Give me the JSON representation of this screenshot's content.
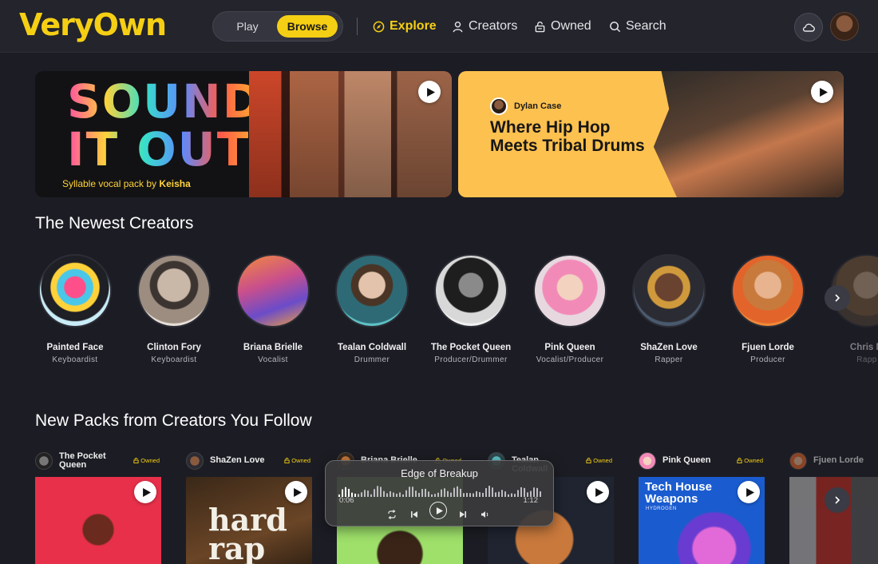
{
  "brand": {
    "logo": "VeryOwn",
    "accent": "#f5cf14"
  },
  "header": {
    "mode_toggle": {
      "play_label": "Play",
      "browse_label": "Browse",
      "selected": "Browse"
    },
    "nav": [
      {
        "label": "Explore",
        "icon": "compass-icon",
        "active": true
      },
      {
        "label": "Creators",
        "icon": "person-icon",
        "active": false
      },
      {
        "label": "Owned",
        "icon": "lock-icon",
        "active": false
      },
      {
        "label": "Search",
        "icon": "search-icon",
        "active": false
      }
    ],
    "cloud_icon": "cloud-icon",
    "user_avatar": "avatar"
  },
  "featured": [
    {
      "art_text": "SOUND IT OUT",
      "caption_prefix": "Syllable vocal pack by",
      "caption_creator": "Keisha",
      "play_icon": "play-icon"
    },
    {
      "author": "Dylan Case",
      "title": "Where Hip Hop Meets Tribal Drums",
      "play_icon": "play-icon"
    }
  ],
  "newest_creators": {
    "heading": "The Newest Creators",
    "items": [
      {
        "name": "Painted Face",
        "role": "Keyboardist"
      },
      {
        "name": "Clinton Fory",
        "role": "Keyboardist"
      },
      {
        "name": "Briana Brielle",
        "role": "Vocalist"
      },
      {
        "name": "Tealan Coldwall",
        "role": "Drummer"
      },
      {
        "name": "The Pocket Queen",
        "role": "Producer/Drummer"
      },
      {
        "name": "Pink Queen",
        "role": "Vocalist/Producer"
      },
      {
        "name": "ShaZen Love",
        "role": "Rapper"
      },
      {
        "name": "Fjuen Lorde",
        "role": "Producer"
      },
      {
        "name": "Chris M",
        "role": "Rapp"
      }
    ]
  },
  "packs_section": {
    "heading": "New Packs from Creators You Follow",
    "owned_label": "Owned",
    "items": [
      {
        "creator": "The Pocket Queen",
        "owned": true,
        "cover_text": ""
      },
      {
        "creator": "ShaZen Love",
        "owned": true,
        "cover_text": "hard rap"
      },
      {
        "creator": "Briana Brielle",
        "owned": true,
        "cover_text": ""
      },
      {
        "creator": "Tealan Coldwall",
        "owned": true,
        "cover_text": ""
      },
      {
        "creator": "Pink Queen",
        "owned": true,
        "cover_text": "Tech House Weapons",
        "cover_subtext": "HYDROGEN"
      },
      {
        "creator": "Fjuen Lorde",
        "owned": false,
        "cover_text": ""
      }
    ]
  },
  "player": {
    "track_title": "Edge of Breakup",
    "elapsed": "0:06",
    "duration": "1:12",
    "controls": [
      "repeat-icon",
      "previous-icon",
      "play-icon",
      "next-icon",
      "volume-icon"
    ]
  }
}
